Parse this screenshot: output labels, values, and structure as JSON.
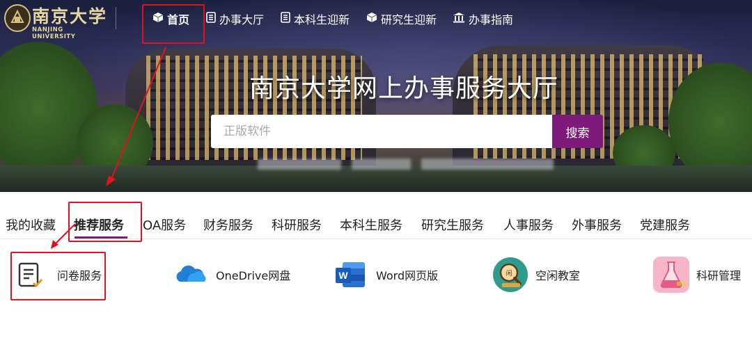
{
  "logo": {
    "name_cn": "南京大学",
    "name_en": "NANJING UNIVERSITY"
  },
  "nav": {
    "items": [
      {
        "label": "首页",
        "icon": "cube-icon",
        "active": true
      },
      {
        "label": "办事大厅",
        "icon": "document-icon"
      },
      {
        "label": "本科生迎新",
        "icon": "document-icon"
      },
      {
        "label": "研究生迎新",
        "icon": "cube-icon"
      },
      {
        "label": "办事指南",
        "icon": "institution-icon"
      }
    ]
  },
  "hero": {
    "title": "南京大学网上办事服务大厅",
    "search_placeholder": "正版软件",
    "search_button": "搜索"
  },
  "tabs": [
    {
      "label": "我的收藏"
    },
    {
      "label": "推荐服务",
      "active": true
    },
    {
      "label": "OA服务"
    },
    {
      "label": "财务服务"
    },
    {
      "label": "科研服务"
    },
    {
      "label": "本科生服务"
    },
    {
      "label": "研究生服务"
    },
    {
      "label": "人事服务"
    },
    {
      "label": "外事服务"
    },
    {
      "label": "党建服务"
    }
  ],
  "services": [
    {
      "label": "问卷服务",
      "icon": "questionnaire-icon"
    },
    {
      "label": "OneDrive网盘",
      "icon": "onedrive-cloud-icon"
    },
    {
      "label": "Word网页版",
      "icon": "word-icon"
    },
    {
      "label": "空闲教室",
      "icon": "classroom-search-icon"
    },
    {
      "label": "科研管理",
      "icon": "research-flask-icon"
    }
  ],
  "colors": {
    "accent": "#7d1a7a",
    "highlight": "#e0121b"
  }
}
